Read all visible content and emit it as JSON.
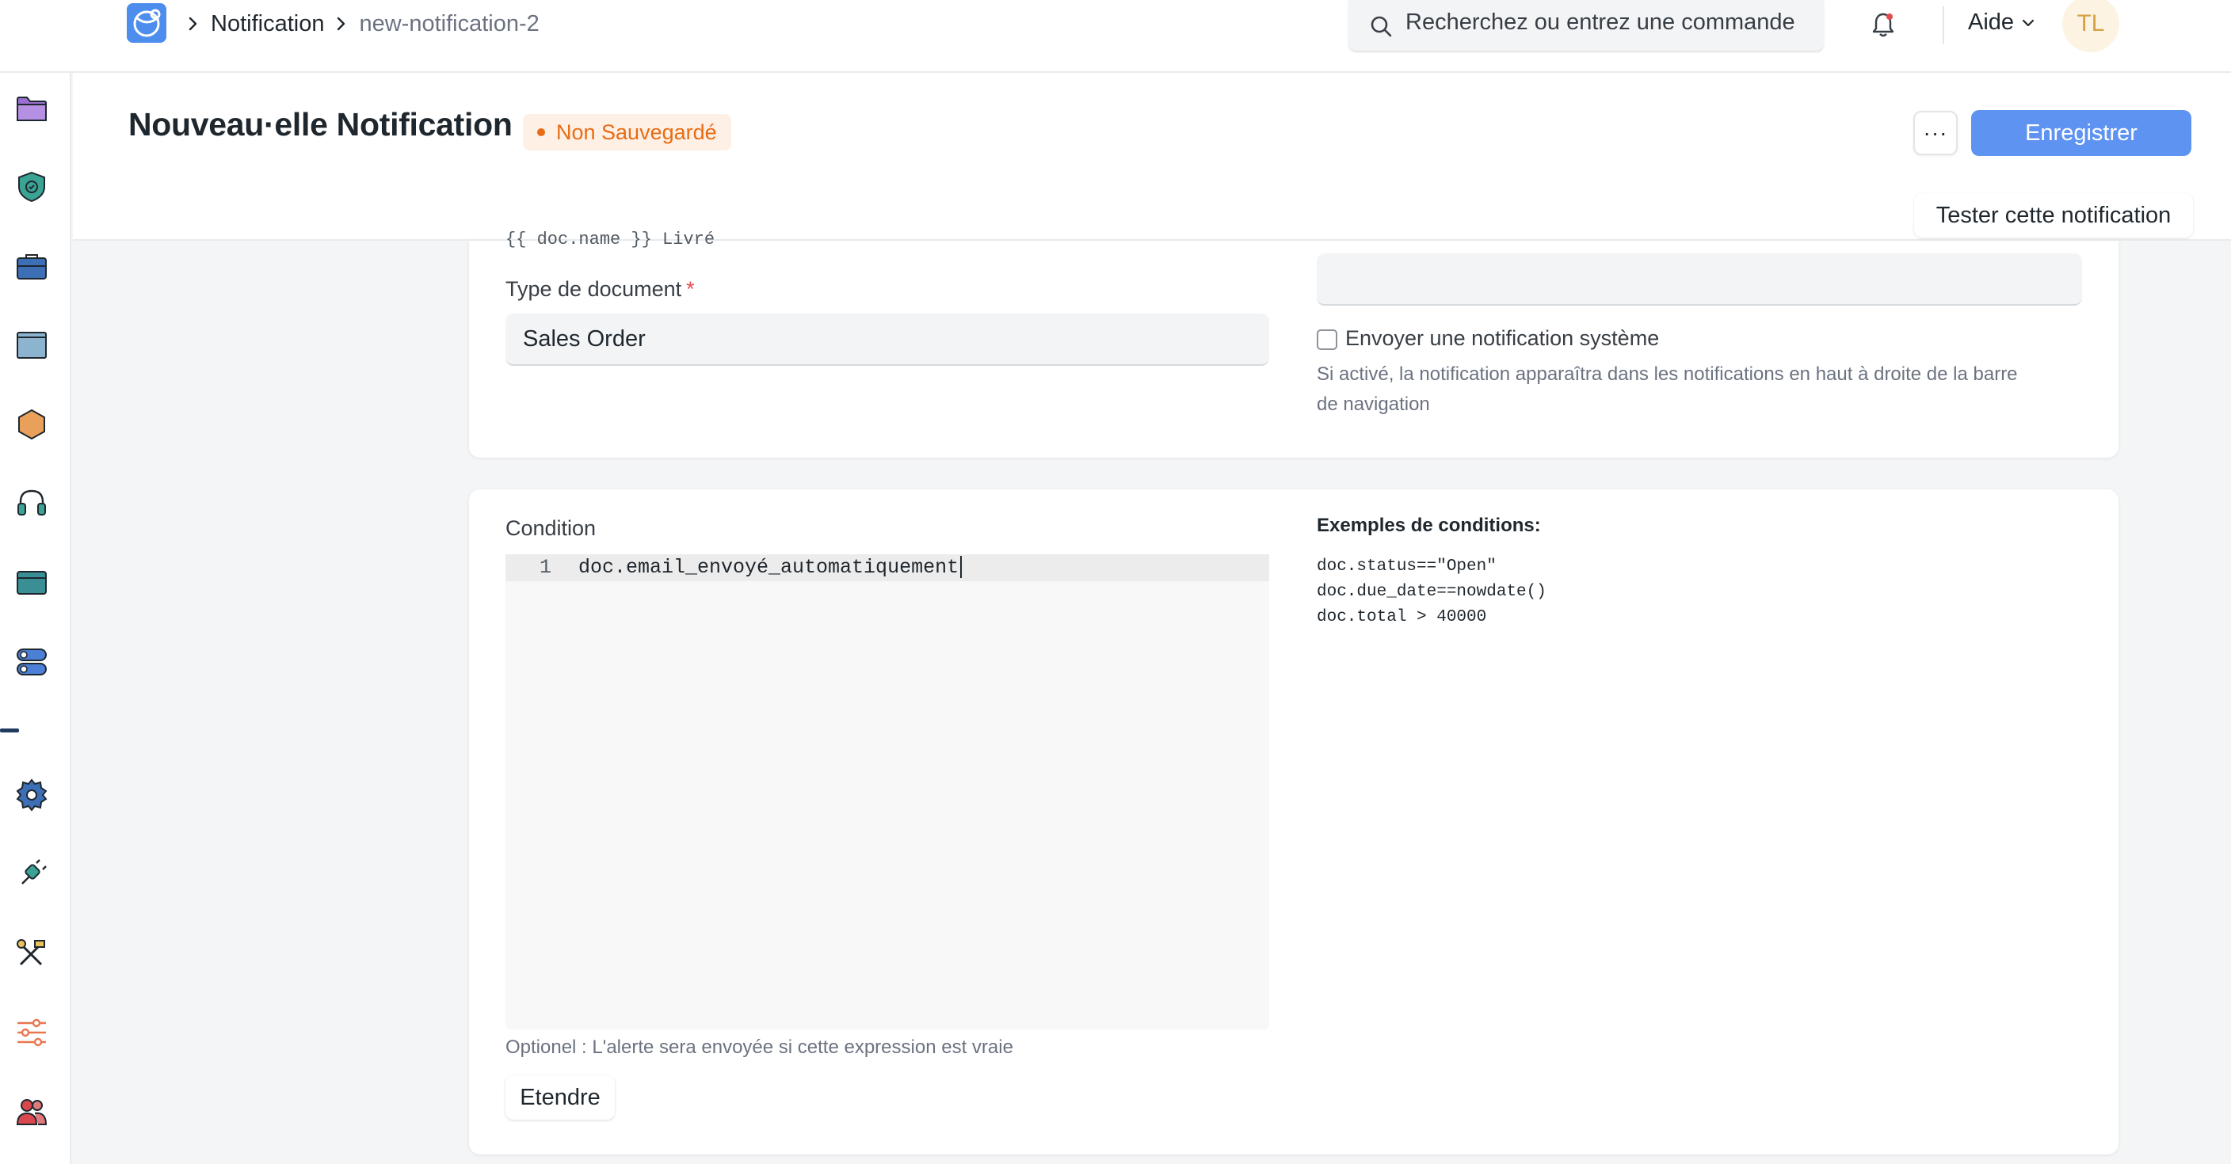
{
  "navbar": {
    "breadcrumbs": [
      "Notification",
      "new-notification-2"
    ],
    "search_placeholder": "Recherchez ou entrez une commande",
    "help_label": "Aide",
    "avatar_initials": "TL"
  },
  "sidebar": {
    "icons": [
      "folder-icon",
      "shield-check-icon",
      "briefcase-icon",
      "window-icon",
      "hexagon-icon",
      "headset-icon",
      "card-icon",
      "toggles-icon",
      "gear-icon",
      "plug-icon",
      "tools-icon",
      "sliders-icon",
      "users-icon"
    ]
  },
  "page": {
    "title": "Nouveau·elle Notification",
    "status": "Non Sauvegardé",
    "more_label": "···",
    "save_label": "Enregistrer",
    "test_label": "Tester cette notification"
  },
  "form": {
    "clipped_text": "{{ doc.name }} Livré",
    "doctype_label": "Type de document",
    "doctype_required": "*",
    "doctype_value": "Sales Order",
    "system_notification_label": "Envoyer une notification système",
    "system_notification_help_1": "Si activé, la notification apparaîtra dans les notifications en haut à droite de la barre",
    "system_notification_help_2": "de navigation",
    "condition_label": "Condition",
    "condition_line_number": "1",
    "condition_code": "doc.email_envoyé_automatiquement",
    "condition_help": "Optionel : L'alerte sera envoyée si cette expression est vraie",
    "expand_label": "Etendre",
    "examples_title": "Exemples de conditions:",
    "examples": [
      "doc.status==\"Open\"",
      "doc.due_date==nowdate()",
      "doc.total > 40000"
    ]
  },
  "colors": {
    "primary": "#5e93f1",
    "badge_text": "#e86c13",
    "badge_bg": "#fff0e6"
  }
}
